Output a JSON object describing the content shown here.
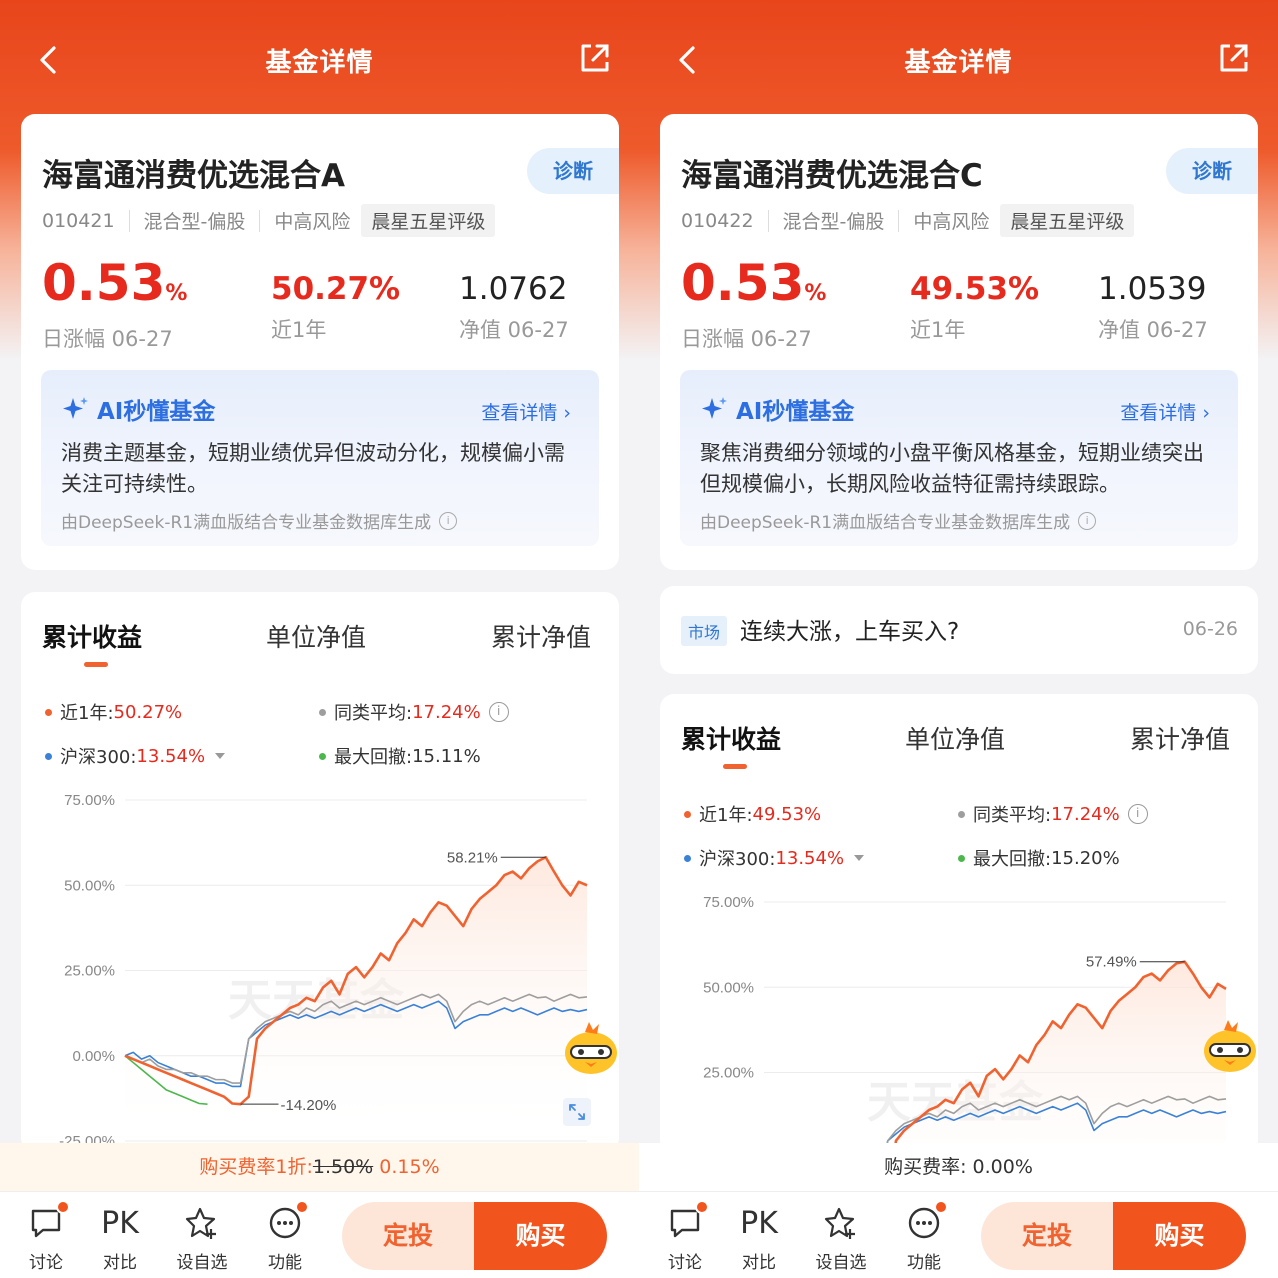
{
  "left": {
    "nav_title": "基金详情",
    "fund_name": "海富通消费优选混合A",
    "diagnose_label": "诊断",
    "code": "010421",
    "type": "混合型-偏股",
    "risk": "中高风险",
    "rating": "晨星五星评级",
    "daily_change_num": "0.53",
    "daily_change_unit": "%",
    "daily_change_label": "日涨幅 06-27",
    "year_return": "50.27%",
    "year_return_label": "近1年",
    "nav_value": "1.0762",
    "nav_label": "净值 06-27",
    "ai_title": "AI秒懂基金",
    "ai_more": "查看详情",
    "ai_text": "消费主题基金，短期业绩优异但波动分化，规模偏小需关注可持续性。",
    "ai_source": "由DeepSeek-R1满血版结合专业基金数据库生成",
    "tabs": [
      "累计收益",
      "单位净值",
      "累计净值"
    ],
    "legend": {
      "l1_label": "近1年:",
      "l1_value": "50.27%",
      "l2_label": "同类平均:",
      "l2_value": "17.24%",
      "l3_label": "沪深300:",
      "l3_value": "13.54%",
      "l4_label": "最大回撤:",
      "l4_value": "15.11%"
    },
    "fee_prefix": "购买费率1折:",
    "fee_old": "1.50%",
    "fee_new": "0.15%",
    "bottom": [
      "讨论",
      "对比",
      "设自选",
      "功能"
    ],
    "pk_label": "PK",
    "btn_sip": "定投",
    "btn_buy": "购买"
  },
  "right": {
    "nav_title": "基金详情",
    "fund_name": "海富通消费优选混合C",
    "diagnose_label": "诊断",
    "code": "010422",
    "type": "混合型-偏股",
    "risk": "中高风险",
    "rating": "晨星五星评级",
    "daily_change_num": "0.53",
    "daily_change_unit": "%",
    "daily_change_label": "日涨幅 06-27",
    "year_return": "49.53%",
    "year_return_label": "近1年",
    "nav_value": "1.0539",
    "nav_label": "净值 06-27",
    "ai_title": "AI秒懂基金",
    "ai_more": "查看详情",
    "ai_text": "聚焦消费细分领域的小盘平衡风格基金，短期业绩突出但规模偏小，长期风险收益特征需持续跟踪。",
    "ai_source": "由DeepSeek-R1满血版结合专业基金数据库生成",
    "news_tag": "市场",
    "news_title": "连续大涨，上车买入?",
    "news_date": "06-26",
    "tabs": [
      "累计收益",
      "单位净值",
      "累计净值"
    ],
    "legend": {
      "l1_label": "近1年:",
      "l1_value": "49.53%",
      "l2_label": "同类平均:",
      "l2_value": "17.24%",
      "l3_label": "沪深300:",
      "l3_value": "13.54%",
      "l4_label": "最大回撤:",
      "l4_value": "15.20%"
    },
    "fee_text": "购买费率: 0.00%",
    "bottom": [
      "讨论",
      "对比",
      "设自选",
      "功能"
    ],
    "pk_label": "PK",
    "btn_sip": "定投",
    "btn_buy": "购买"
  },
  "colors": {
    "brand": "#f2541d",
    "fund_line": "#f06330",
    "csi300_line": "#3b82d6",
    "peer_line": "#9e9e9e",
    "drawdown_line": "#4cb84c",
    "up_red": "#e62a1e",
    "ai_blue": "#2d6fe0"
  },
  "chart_data": [
    {
      "type": "line",
      "title": "累计收益",
      "watermark": "天天基金",
      "yticks": [
        "75.00%",
        "50.00%",
        "25.00%",
        "0.00%",
        "-25.00%"
      ],
      "ylim": [
        -25,
        75
      ],
      "annotations": [
        {
          "label": "58.21%",
          "value": 58.21
        },
        {
          "label": "-14.20%",
          "value": -14.2
        }
      ],
      "series": [
        {
          "name": "近1年",
          "values": [
            0,
            -1,
            -2,
            -3,
            -4,
            -5,
            -6,
            -7,
            -8,
            -9,
            -10,
            -11,
            -12,
            -14,
            -14.2,
            -12,
            5,
            8,
            10,
            12,
            14,
            15,
            17,
            16,
            20,
            22,
            18,
            24,
            26,
            23,
            26,
            30,
            28,
            33,
            36,
            40,
            38,
            42,
            45,
            44,
            41,
            38,
            43,
            46,
            48,
            50,
            53,
            54,
            52,
            55,
            57,
            58.21,
            54,
            50,
            47,
            51,
            50
          ]
        },
        {
          "name": "同类平均",
          "values": [
            0,
            -1,
            -2,
            -1,
            -3,
            -4,
            -4,
            -5,
            -5,
            -6,
            -6,
            -7,
            -7,
            -8,
            -8,
            5,
            8,
            10,
            11,
            12,
            13,
            12,
            14,
            13,
            15,
            16,
            14,
            15,
            16,
            15,
            16,
            17,
            16,
            15,
            16,
            17,
            18,
            17,
            18,
            16,
            10,
            13,
            15,
            16,
            15,
            16,
            17,
            16,
            17,
            18,
            17,
            17.24,
            16,
            17,
            18,
            17,
            17.24
          ]
        },
        {
          "name": "沪深300",
          "values": [
            0,
            1,
            -1,
            0,
            -2,
            -3,
            -4,
            -5,
            -6,
            -6,
            -7,
            -8,
            -8,
            -9,
            -9,
            5,
            7,
            9,
            10,
            11,
            12,
            11,
            12,
            11,
            12,
            13,
            12,
            13,
            14,
            13,
            14,
            15,
            14,
            13,
            14,
            15,
            14,
            15,
            16,
            14,
            8,
            10,
            11,
            12,
            12,
            13,
            14,
            13,
            14,
            13,
            12,
            13,
            14,
            13,
            13.54,
            13,
            13.54
          ]
        },
        {
          "name": "最大回撤",
          "values": [
            0,
            -2,
            -4,
            -6,
            -8,
            -10,
            -11,
            -12,
            -13,
            -14,
            -14.2
          ]
        }
      ]
    },
    {
      "type": "line",
      "title": "累计收益",
      "watermark": "天天基金",
      "yticks": [
        "75.00%",
        "50.00%",
        "25.00%"
      ],
      "ylim": [
        -25,
        75
      ],
      "annotations": [
        {
          "label": "57.49%",
          "value": 57.49
        }
      ],
      "series": [
        {
          "name": "近1年",
          "values": [
            0,
            -1,
            -2,
            -3,
            -4,
            -5,
            -6,
            -7,
            -8,
            -9,
            -10,
            -11,
            -12,
            -14,
            -14,
            -12,
            5,
            8,
            10,
            12,
            14,
            15,
            17,
            16,
            20,
            22,
            18,
            24,
            26,
            23,
            26,
            30,
            28,
            33,
            36,
            40,
            38,
            42,
            45,
            44,
            41,
            38,
            43,
            46,
            48,
            50,
            53,
            54,
            52,
            55,
            57,
            57.49,
            54,
            50,
            47,
            51,
            49.53
          ]
        },
        {
          "name": "同类平均",
          "values": [
            0,
            -1,
            -2,
            -1,
            -3,
            -4,
            -4,
            -5,
            -5,
            -6,
            -6,
            -7,
            -7,
            -8,
            -8,
            5,
            8,
            10,
            11,
            12,
            13,
            12,
            14,
            13,
            15,
            16,
            14,
            15,
            16,
            15,
            16,
            17,
            16,
            15,
            16,
            17,
            18,
            17,
            18,
            16,
            10,
            13,
            15,
            16,
            15,
            16,
            17,
            16,
            17,
            18,
            17,
            17.24,
            16,
            17,
            18,
            17,
            17.24
          ]
        },
        {
          "name": "沪深300",
          "values": [
            0,
            1,
            -1,
            0,
            -2,
            -3,
            -4,
            -5,
            -6,
            -6,
            -7,
            -8,
            -8,
            -9,
            -9,
            5,
            7,
            9,
            10,
            11,
            12,
            11,
            12,
            11,
            12,
            13,
            12,
            13,
            14,
            13,
            14,
            15,
            14,
            13,
            14,
            15,
            14,
            15,
            16,
            14,
            8,
            10,
            11,
            12,
            12,
            13,
            14,
            13,
            14,
            13,
            12,
            13,
            14,
            13,
            13.54,
            13,
            13.54
          ]
        }
      ]
    }
  ]
}
